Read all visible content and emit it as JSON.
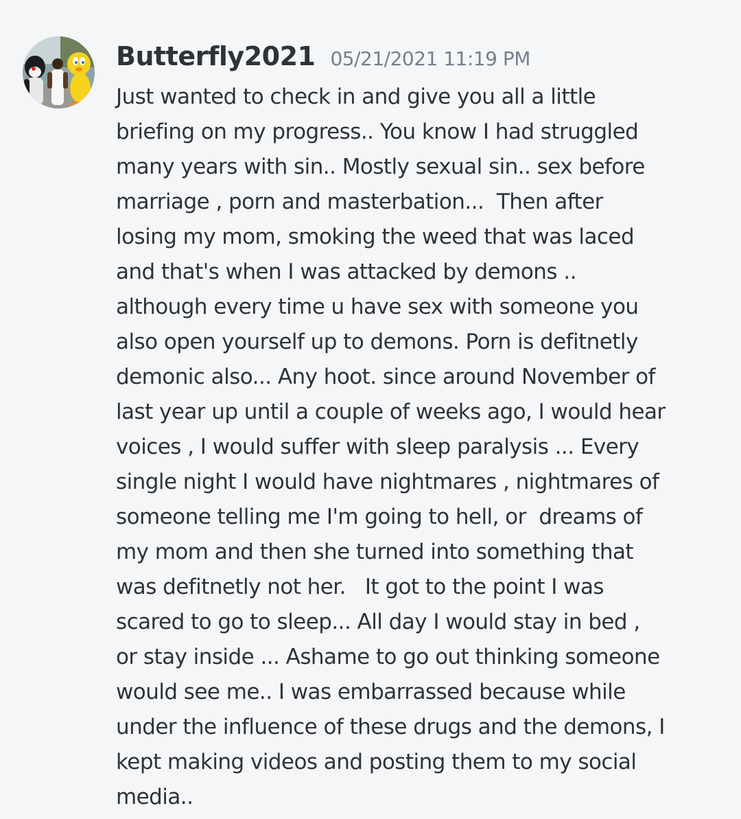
{
  "message": {
    "author": "Butterfly2021",
    "timestamp": "05/21/2021 11:19 PM",
    "avatar_icon": "user-photo-avatar",
    "lines": [
      "Just wanted to check in and give you all a little",
      "briefing on my progress.. You know I had struggled",
      "many years with sin.. Mostly sexual sin.. sex before",
      "marriage , porn and masterbation...  Then after",
      "losing my mom, smoking the weed that was laced",
      "and that's when I was attacked by demons ..",
      "although every time u have sex with someone you",
      "also open yourself up to demons. Porn is defitnetly",
      "demonic also... Any hoot. since around November of",
      "last year up until a couple of weeks ago, I would hear",
      "voices , I would suffer with sleep paralysis ... Every",
      "single night I would have nightmares , nightmares of",
      "someone telling me I'm going to hell, or  dreams of",
      "my mom and then she turned into something that",
      "was defitnetly not her.   It got to the point I was",
      "scared to go to sleep... All day I would stay in bed ,",
      "or stay inside ... Ashame to go out thinking someone",
      "would see me.. I was embarrassed because while",
      "under the influence of these drugs and the demons, I",
      "kept making videos and posting them to my social",
      "media.."
    ]
  },
  "colors": {
    "background": "#f5f6f7",
    "username": "#2e3338",
    "timestamp": "#747f8d",
    "text": "#2e3338"
  }
}
